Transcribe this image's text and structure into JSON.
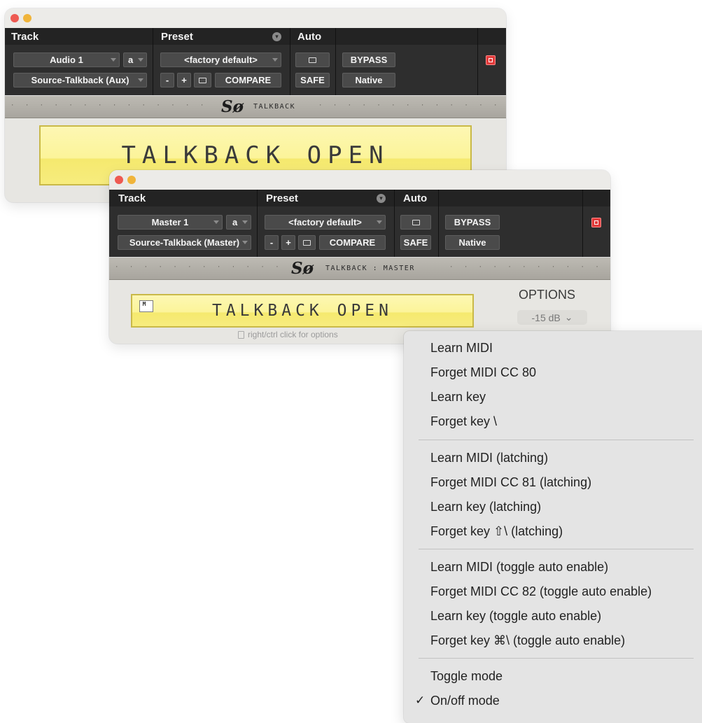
{
  "window_a": {
    "header": {
      "track": "Track",
      "preset": "Preset",
      "auto": "Auto"
    },
    "track_name": "Audio 1",
    "channel": "a",
    "preset_name": "<factory default>",
    "bypass": "BYPASS",
    "sidechain": "Source-Talkback (Aux)",
    "minus": "-",
    "plus": "+",
    "compare": "COMPARE",
    "safe": "SAFE",
    "native": "Native",
    "logo": "Sø",
    "plugin_name": "TALKBACK",
    "dots_left": "· · · · · · · · · · · · · · · · · · · · · · · · · · ·",
    "dots_right": "· · · · · · · · · · · · · · · · · · · · · · · · · · · · · ·",
    "talk_button": "TALKBACK OPEN"
  },
  "window_b": {
    "header": {
      "track": "Track",
      "preset": "Preset",
      "auto": "Auto"
    },
    "track_name": "Master 1",
    "channel": "a",
    "preset_name": "<factory default>",
    "bypass": "BYPASS",
    "sidechain": "Source-Talkback (Master)",
    "minus": "-",
    "plus": "+",
    "compare": "COMPARE",
    "safe": "SAFE",
    "native": "Native",
    "logo": "Sø",
    "plugin_name": "TALKBACK : MASTER",
    "dots_left": "· · · · · · · · · · · · · · · · · · · · · · · ·",
    "dots_right": "· · · · · · · · · · · · · · · · · · · · · · · · · · ·",
    "m_badge": "M",
    "talk_button": "TALKBACK OPEN",
    "options_title": "OPTIONS",
    "options_value": "-15 dB",
    "options_chevron": "⌄",
    "hint": "right/ctrl click for options"
  },
  "menu": {
    "group1": [
      "Learn MIDI",
      "Forget MIDI CC 80",
      "Learn key",
      "Forget key \\"
    ],
    "group2": [
      "Learn MIDI (latching)",
      "Forget MIDI CC 81 (latching)",
      "Learn key (latching)",
      "Forget key ⇧\\ (latching)"
    ],
    "group3": [
      "Learn MIDI (toggle auto enable)",
      "Forget MIDI CC 82 (toggle auto enable)",
      "Learn key (toggle auto enable)",
      "Forget key ⌘\\ (toggle auto enable)"
    ],
    "group4": [
      "Toggle mode",
      "On/off mode"
    ],
    "check": "✓"
  },
  "colors": {
    "header_bg": "#2e2e2e",
    "talk_yellow": "#fcf499",
    "insert_red": "#e23a3a",
    "menu_bg": "#e4e4e4"
  }
}
